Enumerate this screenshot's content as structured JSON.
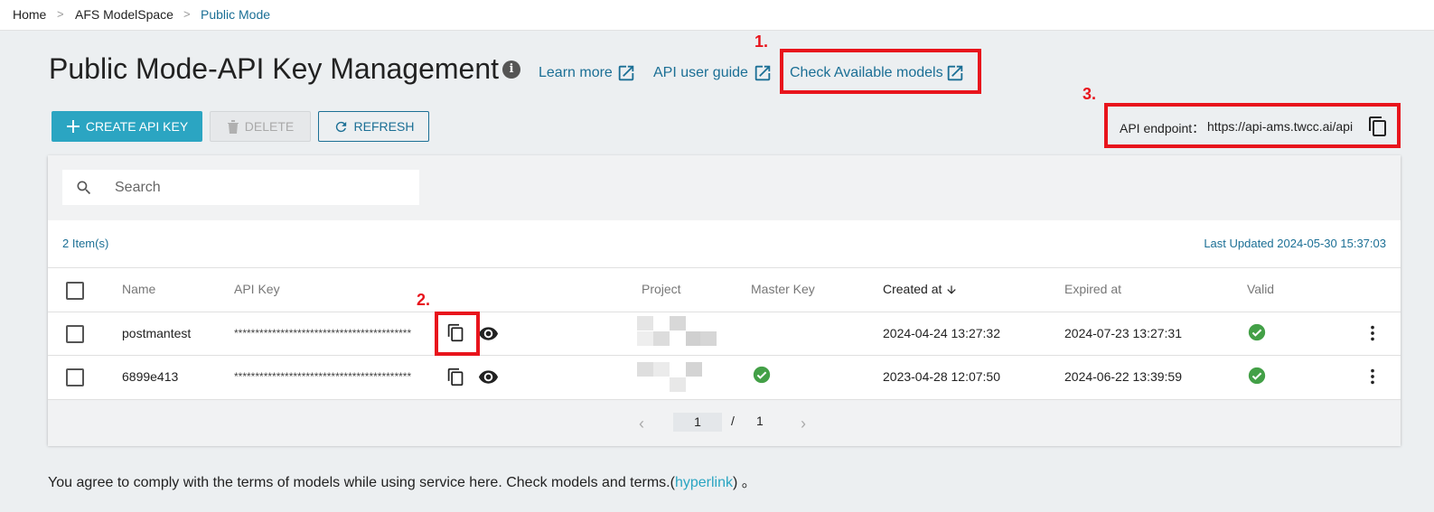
{
  "breadcrumb": [
    {
      "label": "Home"
    },
    {
      "label": "AFS ModelSpace"
    },
    {
      "label": "Public Mode"
    }
  ],
  "breadcrumb_separator": ">",
  "page_title": "Public Mode-API Key Management",
  "header_links": {
    "learn_more": "Learn more",
    "api_user_guide": "API user guide",
    "check_models": "Check Available models"
  },
  "annotations": {
    "one": "1.",
    "two": "2.",
    "three": "3."
  },
  "toolbar": {
    "create_label": "CREATE API KEY",
    "delete_label": "DELETE",
    "refresh_label": "REFRESH"
  },
  "endpoint": {
    "label": "API endpoint：",
    "value": "https://api-ams.twcc.ai/api"
  },
  "search": {
    "placeholder": "Search"
  },
  "table": {
    "item_count": "2 Item(s)",
    "last_updated": "Last Updated 2024-05-30 15:37:03",
    "columns": {
      "name": "Name",
      "api_key": "API Key",
      "project": "Project",
      "master_key": "Master Key",
      "created_at": "Created at",
      "expired_at": "Expired at",
      "valid": "Valid"
    },
    "rows": [
      {
        "name": "postmantest",
        "api_key": "******************************************",
        "master_key": false,
        "created_at": "2024-04-24 13:27:32",
        "expired_at": "2024-07-23 13:27:31",
        "valid": true
      },
      {
        "name": "6899e413",
        "api_key": "******************************************",
        "master_key": true,
        "created_at": "2023-04-28 12:07:50",
        "expired_at": "2024-06-22 13:39:59",
        "valid": true
      }
    ]
  },
  "pagination": {
    "current": "1",
    "separator": "/",
    "total": "1"
  },
  "terms": {
    "prefix": "You agree to comply with the terms of models while using service here. Check models and terms.(",
    "link": "hyperlink",
    "suffix": ") 。"
  },
  "colors": {
    "accent": "#2ba5c2",
    "link": "#1b6f95",
    "highlight_red": "#e8141c",
    "valid_green": "#43a047"
  },
  "icons": [
    "info-icon",
    "external-link-icon",
    "plus-icon",
    "trash-icon",
    "refresh-icon",
    "copy-icon",
    "eye-icon",
    "search-icon",
    "arrow-down-icon",
    "check-circle-icon",
    "more-vert-icon",
    "chevron-left-icon",
    "chevron-right-icon"
  ]
}
